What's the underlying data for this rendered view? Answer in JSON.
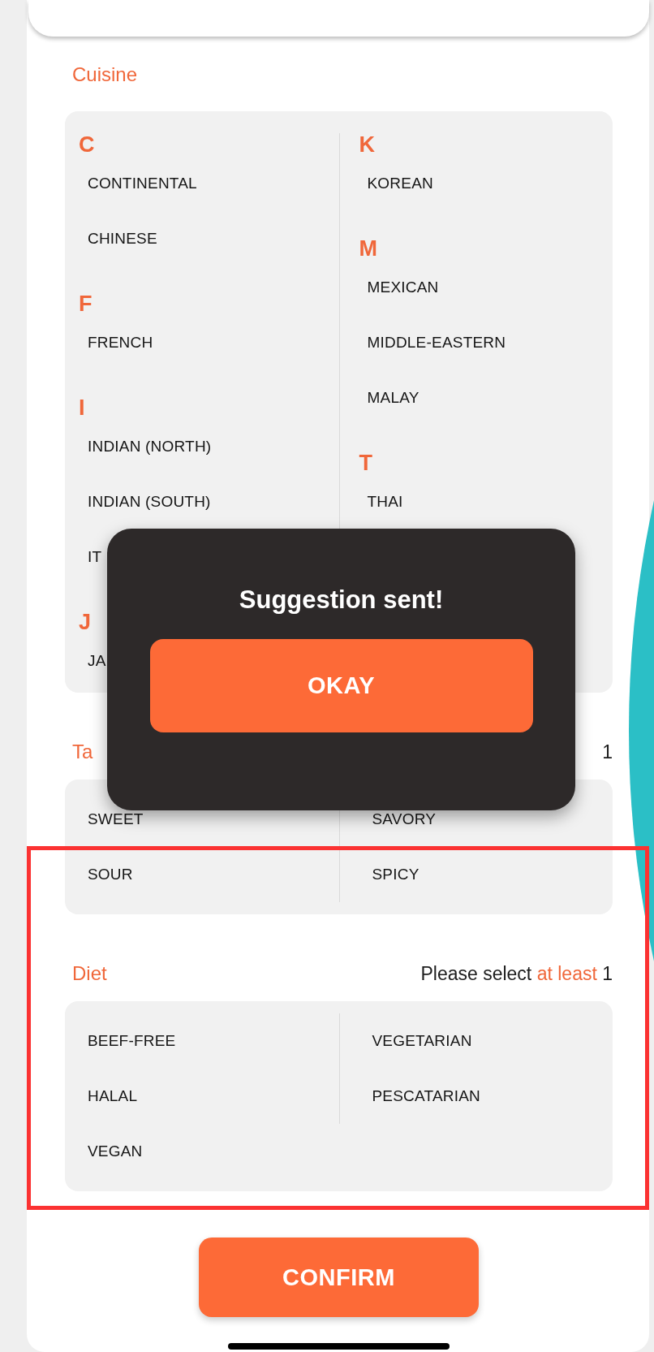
{
  "sections": [
    {
      "kind": "grouped",
      "title": "Cuisine",
      "columns": [
        [
          {
            "letter": "C",
            "items": [
              "CONTINENTAL",
              "CHINESE"
            ]
          },
          {
            "letter": "F",
            "items": [
              "FRENCH"
            ]
          },
          {
            "letter": "I",
            "items": [
              "INDIAN (NORTH)",
              "INDIAN (SOUTH)",
              "IT"
            ]
          },
          {
            "letter": "J",
            "items": [
              "JA"
            ]
          }
        ],
        [
          {
            "letter": "K",
            "items": [
              "KOREAN"
            ]
          },
          {
            "letter": "M",
            "items": [
              "MEXICAN",
              "MIDDLE-EASTERN",
              "MALAY"
            ]
          },
          {
            "letter": "T",
            "items": [
              "THAI"
            ]
          }
        ]
      ]
    },
    {
      "kind": "plain",
      "title": "Ta",
      "hint": {
        "count": "1"
      },
      "columns": [
        [
          "SWEET",
          "SOUR"
        ],
        [
          "SAVORY",
          "SPICY"
        ]
      ]
    },
    {
      "kind": "plain",
      "title": "Diet",
      "hint": {
        "text": "Please select",
        "emphasis": "at least",
        "count": "1"
      },
      "columns": [
        [
          "BEEF-FREE",
          "HALAL",
          "VEGAN"
        ],
        [
          "VEGETARIAN",
          "PESCATARIAN"
        ]
      ]
    }
  ],
  "confirm_button": "CONFIRM",
  "dialog": {
    "message": "Suggestion sent!",
    "button": "OKAY"
  }
}
